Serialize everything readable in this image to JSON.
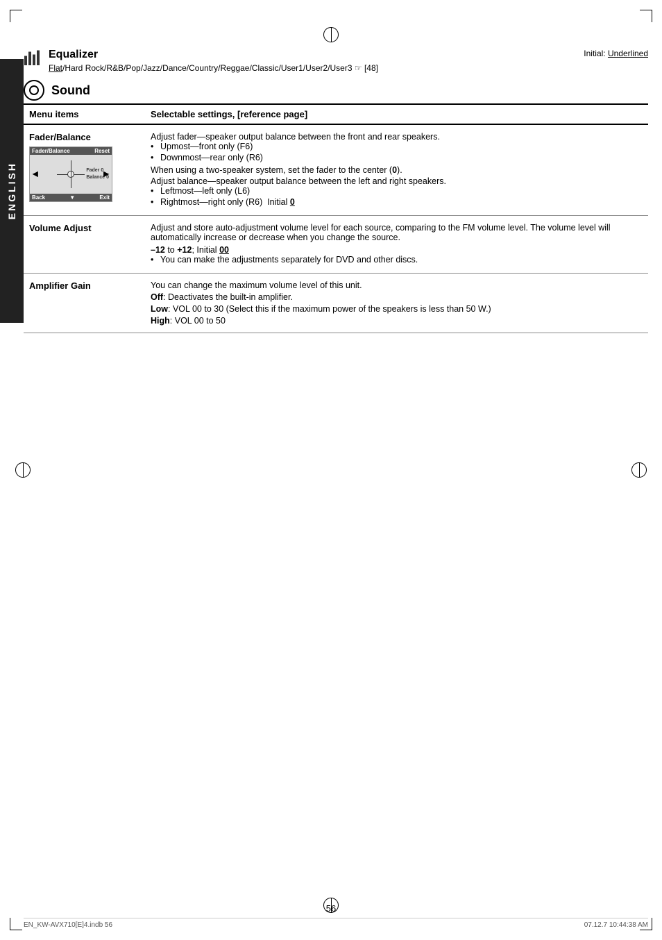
{
  "page": {
    "number": "56",
    "footer_left": "EN_KW-AVX710[E]4.indb  56",
    "footer_right": "07.12.7  10:44:38 AM"
  },
  "initial_note": "Initial: Underlined",
  "equalizer": {
    "title": "Equalizer",
    "subtitle_flat": "Flat",
    "subtitle_rest": "/Hard Rock/R&B/Pop/Jazz/Dance/Country/Reggae/Classic/User1/User2/User3",
    "subtitle_ref": "☞ [48]"
  },
  "sound": {
    "title": "Sound",
    "col_menu": "Menu items",
    "col_settings": "Selectable settings, [reference page]"
  },
  "rows": [
    {
      "id": "fader-balance",
      "menu": "Fader/Balance",
      "description_lines": [
        "Adjust fader—speaker output balance between the front and rear speakers.",
        "• Upmost—front only (F6)",
        "• Downmost—rear only (R6)",
        "When using a two-speaker system, set the fader to the center (0).",
        "Adjust balance—speaker output balance between the left and right speakers.",
        "• Leftmost—left only (L6)",
        "• Rightmost—right only (R6)  Initial 0"
      ],
      "has_image": true
    },
    {
      "id": "volume-adjust",
      "menu": "Volume Adjust",
      "description_lines": [
        "Adjust and store auto-adjustment volume level for each source, comparing to the FM volume level. The volume level will automatically increase or decrease when you change the source.",
        "–12 to +12; Initial 00",
        "• You can make the adjustments separately for DVD and other discs."
      ]
    },
    {
      "id": "amplifier-gain",
      "menu": "Amplifier Gain",
      "description_lines": [
        "You can change the maximum volume level of this unit.",
        "Off: Deactivates the built-in amplifier.",
        "Low: VOL 00 to 30 (Select this if the maximum power of the speakers is less than 50 W.)",
        "High: VOL 00 to 50"
      ]
    }
  ],
  "sidebar": {
    "label": "ENGLISH"
  }
}
